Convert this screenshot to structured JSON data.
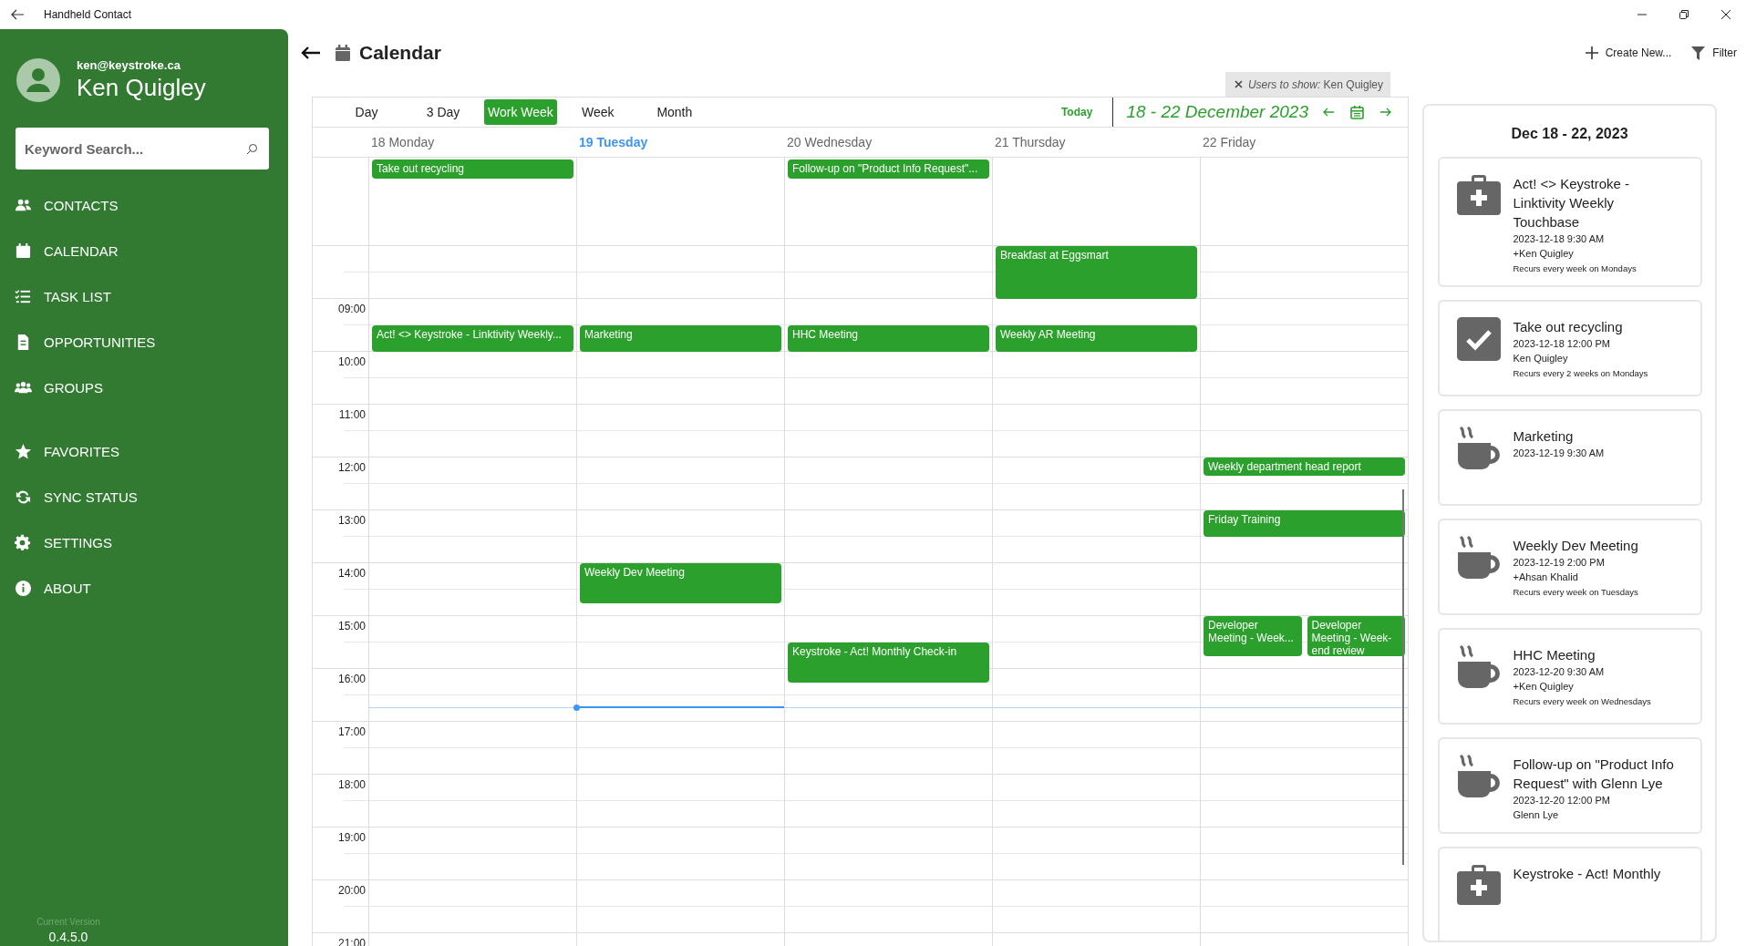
{
  "window": {
    "title": "Handheld Contact"
  },
  "user": {
    "email": "ken@keystroke.ca",
    "name": "Ken Quigley"
  },
  "search": {
    "placeholder": "Keyword Search..."
  },
  "sidebar": {
    "sections": [
      {
        "items": [
          {
            "label": "CONTACTS"
          },
          {
            "label": "CALENDAR"
          },
          {
            "label": "TASK LIST"
          },
          {
            "label": "OPPORTUNITIES"
          },
          {
            "label": "GROUPS"
          }
        ]
      },
      {
        "items": [
          {
            "label": "FAVORITES"
          },
          {
            "label": "SYNC STATUS"
          },
          {
            "label": "SETTINGS"
          },
          {
            "label": "ABOUT"
          }
        ]
      }
    ],
    "version_label": "Current Version",
    "version": "0.4.5.0"
  },
  "page": {
    "title": "Calendar",
    "actions": [
      {
        "label": "Create New..."
      },
      {
        "label": "Filter"
      }
    ]
  },
  "users_filter": {
    "label": "Users to show:",
    "value": "Ken Quigley"
  },
  "calendar": {
    "views": [
      {
        "label": "Day",
        "selected": false
      },
      {
        "label": "3 Day",
        "selected": false
      },
      {
        "label": "Work Week",
        "selected": true
      },
      {
        "label": "Week",
        "selected": false
      },
      {
        "label": "Month",
        "selected": false
      }
    ],
    "today_button": "Today",
    "range": "18  - 22 December 2023",
    "time_labels": [
      "09:00",
      "10:00",
      "11:00",
      "12:00",
      "13:00",
      "14:00",
      "15:00",
      "16:00",
      "17:00",
      "18:00",
      "19:00",
      "20:00",
      "21:00"
    ],
    "days": [
      {
        "label": "18 Monday",
        "today": false,
        "events": [
          {
            "title": "Take out recycling"
          },
          {
            "title": "Act! <> Keystroke -  Linktivity Weekly..."
          }
        ]
      },
      {
        "label": "19 Tuesday",
        "today": true,
        "events": [
          {
            "title": "Marketing"
          },
          {
            "title": "Weekly Dev Meeting"
          }
        ]
      },
      {
        "label": "20 Wednesday",
        "today": false,
        "events": [
          {
            "title": "Follow-up on \"Product Info Request\"..."
          },
          {
            "title": "HHC Meeting"
          },
          {
            "title": "Keystroke - Act! Monthly Check-in"
          }
        ]
      },
      {
        "label": "21 Thursday",
        "today": false,
        "events": [
          {
            "title": "Breakfast at Eggsmart"
          },
          {
            "title": "Weekly AR Meeting"
          }
        ]
      },
      {
        "label": "22 Friday",
        "today": false,
        "events": [
          {
            "title": "Weekly department head report"
          },
          {
            "title": "Friday Training"
          },
          {
            "title": "Developer Meeting - Week..."
          },
          {
            "title": "Developer Meeting - Week-end review"
          }
        ]
      }
    ]
  },
  "agenda": {
    "title": "Dec 18 - 22, 2023",
    "items": [
      {
        "kind": "appointment",
        "title": "Act! <> Keystroke - Linktivity Weekly Touchbase",
        "when": "2023-12-18 9:30 AM",
        "who": "+Ken Quigley",
        "recurrence": "Recurs every week on Mondays"
      },
      {
        "kind": "todo",
        "title": "Take out recycling",
        "when": "2023-12-18 12:00 PM",
        "who": "Ken Quigley",
        "recurrence": "Recurs every 2 weeks on Mondays"
      },
      {
        "kind": "meeting",
        "title": "Marketing",
        "when": "2023-12-19 9:30 AM"
      },
      {
        "kind": "meeting",
        "title": "Weekly Dev Meeting",
        "when": "2023-12-19 2:00 PM",
        "who": "+Ahsan Khalid",
        "recurrence": "Recurs every week on Tuesdays"
      },
      {
        "kind": "meeting",
        "title": "HHC Meeting",
        "when": "2023-12-20 9:30 AM",
        "who": "+Ken Quigley",
        "recurrence": "Recurs every week on Wednesdays"
      },
      {
        "kind": "meeting",
        "title": "Follow-up on \"Product Info Request\" with Glenn Lye",
        "when": "2023-12-20 12:00 PM",
        "who": "Glenn Lye"
      },
      {
        "kind": "appointment",
        "title": "Keystroke - Act! Monthly"
      }
    ]
  }
}
